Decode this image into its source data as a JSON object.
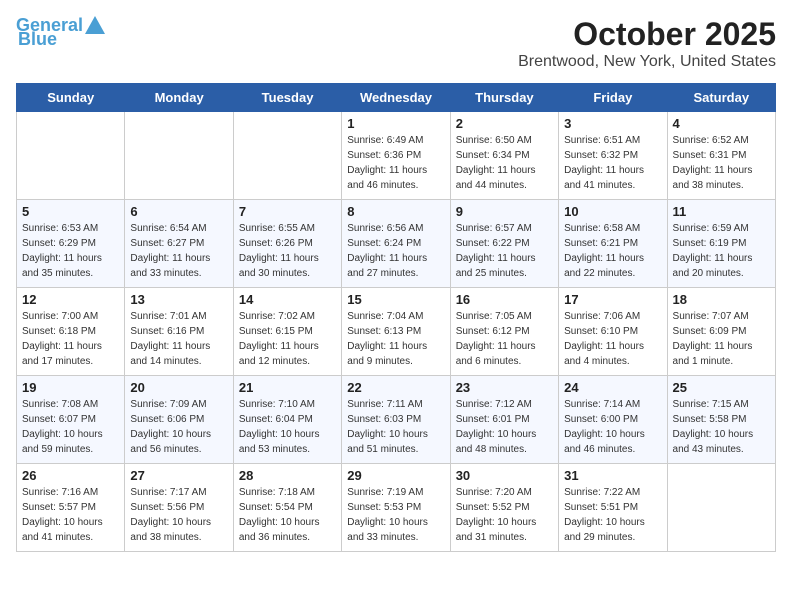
{
  "header": {
    "logo_line1": "General",
    "logo_line2": "Blue",
    "month_year": "October 2025",
    "location": "Brentwood, New York, United States"
  },
  "weekdays": [
    "Sunday",
    "Monday",
    "Tuesday",
    "Wednesday",
    "Thursday",
    "Friday",
    "Saturday"
  ],
  "weeks": [
    [
      {
        "day": "",
        "info": ""
      },
      {
        "day": "",
        "info": ""
      },
      {
        "day": "",
        "info": ""
      },
      {
        "day": "1",
        "info": "Sunrise: 6:49 AM\nSunset: 6:36 PM\nDaylight: 11 hours\nand 46 minutes."
      },
      {
        "day": "2",
        "info": "Sunrise: 6:50 AM\nSunset: 6:34 PM\nDaylight: 11 hours\nand 44 minutes."
      },
      {
        "day": "3",
        "info": "Sunrise: 6:51 AM\nSunset: 6:32 PM\nDaylight: 11 hours\nand 41 minutes."
      },
      {
        "day": "4",
        "info": "Sunrise: 6:52 AM\nSunset: 6:31 PM\nDaylight: 11 hours\nand 38 minutes."
      }
    ],
    [
      {
        "day": "5",
        "info": "Sunrise: 6:53 AM\nSunset: 6:29 PM\nDaylight: 11 hours\nand 35 minutes."
      },
      {
        "day": "6",
        "info": "Sunrise: 6:54 AM\nSunset: 6:27 PM\nDaylight: 11 hours\nand 33 minutes."
      },
      {
        "day": "7",
        "info": "Sunrise: 6:55 AM\nSunset: 6:26 PM\nDaylight: 11 hours\nand 30 minutes."
      },
      {
        "day": "8",
        "info": "Sunrise: 6:56 AM\nSunset: 6:24 PM\nDaylight: 11 hours\nand 27 minutes."
      },
      {
        "day": "9",
        "info": "Sunrise: 6:57 AM\nSunset: 6:22 PM\nDaylight: 11 hours\nand 25 minutes."
      },
      {
        "day": "10",
        "info": "Sunrise: 6:58 AM\nSunset: 6:21 PM\nDaylight: 11 hours\nand 22 minutes."
      },
      {
        "day": "11",
        "info": "Sunrise: 6:59 AM\nSunset: 6:19 PM\nDaylight: 11 hours\nand 20 minutes."
      }
    ],
    [
      {
        "day": "12",
        "info": "Sunrise: 7:00 AM\nSunset: 6:18 PM\nDaylight: 11 hours\nand 17 minutes."
      },
      {
        "day": "13",
        "info": "Sunrise: 7:01 AM\nSunset: 6:16 PM\nDaylight: 11 hours\nand 14 minutes."
      },
      {
        "day": "14",
        "info": "Sunrise: 7:02 AM\nSunset: 6:15 PM\nDaylight: 11 hours\nand 12 minutes."
      },
      {
        "day": "15",
        "info": "Sunrise: 7:04 AM\nSunset: 6:13 PM\nDaylight: 11 hours\nand 9 minutes."
      },
      {
        "day": "16",
        "info": "Sunrise: 7:05 AM\nSunset: 6:12 PM\nDaylight: 11 hours\nand 6 minutes."
      },
      {
        "day": "17",
        "info": "Sunrise: 7:06 AM\nSunset: 6:10 PM\nDaylight: 11 hours\nand 4 minutes."
      },
      {
        "day": "18",
        "info": "Sunrise: 7:07 AM\nSunset: 6:09 PM\nDaylight: 11 hours\nand 1 minute."
      }
    ],
    [
      {
        "day": "19",
        "info": "Sunrise: 7:08 AM\nSunset: 6:07 PM\nDaylight: 10 hours\nand 59 minutes."
      },
      {
        "day": "20",
        "info": "Sunrise: 7:09 AM\nSunset: 6:06 PM\nDaylight: 10 hours\nand 56 minutes."
      },
      {
        "day": "21",
        "info": "Sunrise: 7:10 AM\nSunset: 6:04 PM\nDaylight: 10 hours\nand 53 minutes."
      },
      {
        "day": "22",
        "info": "Sunrise: 7:11 AM\nSunset: 6:03 PM\nDaylight: 10 hours\nand 51 minutes."
      },
      {
        "day": "23",
        "info": "Sunrise: 7:12 AM\nSunset: 6:01 PM\nDaylight: 10 hours\nand 48 minutes."
      },
      {
        "day": "24",
        "info": "Sunrise: 7:14 AM\nSunset: 6:00 PM\nDaylight: 10 hours\nand 46 minutes."
      },
      {
        "day": "25",
        "info": "Sunrise: 7:15 AM\nSunset: 5:58 PM\nDaylight: 10 hours\nand 43 minutes."
      }
    ],
    [
      {
        "day": "26",
        "info": "Sunrise: 7:16 AM\nSunset: 5:57 PM\nDaylight: 10 hours\nand 41 minutes."
      },
      {
        "day": "27",
        "info": "Sunrise: 7:17 AM\nSunset: 5:56 PM\nDaylight: 10 hours\nand 38 minutes."
      },
      {
        "day": "28",
        "info": "Sunrise: 7:18 AM\nSunset: 5:54 PM\nDaylight: 10 hours\nand 36 minutes."
      },
      {
        "day": "29",
        "info": "Sunrise: 7:19 AM\nSunset: 5:53 PM\nDaylight: 10 hours\nand 33 minutes."
      },
      {
        "day": "30",
        "info": "Sunrise: 7:20 AM\nSunset: 5:52 PM\nDaylight: 10 hours\nand 31 minutes."
      },
      {
        "day": "31",
        "info": "Sunrise: 7:22 AM\nSunset: 5:51 PM\nDaylight: 10 hours\nand 29 minutes."
      },
      {
        "day": "",
        "info": ""
      }
    ]
  ]
}
